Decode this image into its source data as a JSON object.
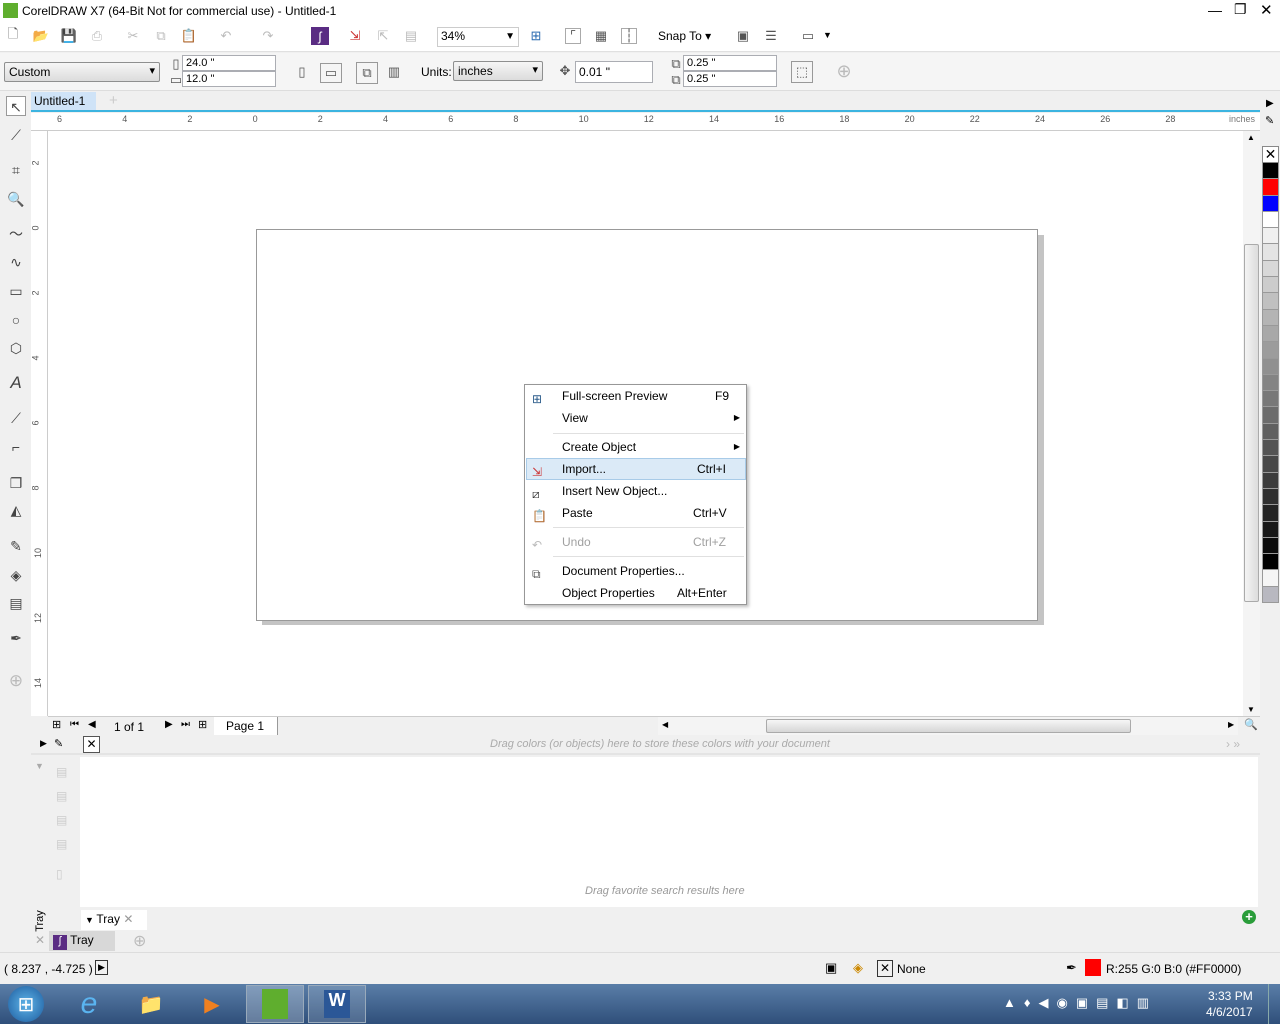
{
  "window": {
    "title": "CorelDRAW X7 (64-Bit Not for commercial use) - Untitled-1"
  },
  "toolbar": {
    "zoom": "34%",
    "snap_to": "Snap To"
  },
  "property_bar": {
    "page_size": "Custom",
    "width": "24.0 \"",
    "height": "12.0 \"",
    "units_label": "Units:",
    "units": "inches",
    "nudge": "0.01 \"",
    "dup_x": "0.25 \"",
    "dup_y": "0.25 \""
  },
  "document_tab": {
    "label": "Untitled-1"
  },
  "ruler": {
    "unit": "inches",
    "h_labels": [
      "6",
      "4",
      "2",
      "0",
      "2",
      "4",
      "6",
      "8",
      "10",
      "12",
      "14",
      "16",
      "18",
      "20",
      "22",
      "24",
      "26",
      "28"
    ],
    "v_labels": [
      "2",
      "0",
      "2",
      "4",
      "6",
      "8",
      "10",
      "12",
      "14"
    ]
  },
  "context_menu": {
    "items": [
      {
        "label": "Full-screen Preview",
        "shortcut": "F9",
        "icon": "fullscreen-preview-icon"
      },
      {
        "label": "View",
        "submenu": true
      },
      {
        "label": "Create Object",
        "submenu": true
      },
      {
        "label": "Import...",
        "shortcut": "Ctrl+I",
        "icon": "import-icon",
        "highlighted": true
      },
      {
        "label": "Insert New Object...",
        "icon": "insert-object-icon"
      },
      {
        "label": "Paste",
        "shortcut": "Ctrl+V",
        "icon": "paste-icon"
      },
      {
        "label": "Undo",
        "shortcut": "Ctrl+Z",
        "icon": "undo-icon",
        "disabled": true
      },
      {
        "label": "Document Properties...",
        "icon": "document-properties-icon"
      },
      {
        "label": "Object Properties",
        "shortcut": "Alt+Enter"
      }
    ]
  },
  "page_nav": {
    "count": "1 of 1",
    "page_tab": "Page 1"
  },
  "doc_palette": {
    "hint": "Drag colors (or objects) here to store these colors with your document"
  },
  "tray": {
    "hint": "Drag favorite search results here",
    "tab": "Tray",
    "bottom_tab": "Tray",
    "side_label": "Tray"
  },
  "status": {
    "coords": "( 8.237 , -4.725 )",
    "fill": "None",
    "outline": "R:255 G:0 B:0 (#FF0000)",
    "outline_color": "#FF0000"
  },
  "palette": [
    "#000000",
    "#FF0000",
    "#0000FF",
    "#FFFFFF",
    "#F0F0F0",
    "#E4E4E4",
    "#D8D8D8",
    "#CCCCCC",
    "#C0C0C0",
    "#B4B4B4",
    "#A8A8A8",
    "#9C9C9C",
    "#909090",
    "#848484",
    "#787878",
    "#6C6C6C",
    "#606060",
    "#545454",
    "#484848",
    "#3C3C3C",
    "#303030",
    "#242424",
    "#181818",
    "#0C0C0C",
    "#000000",
    "#F5F5F5",
    "#B8B8C0"
  ],
  "taskbar": {
    "time": "3:33 PM",
    "date": "4/6/2017"
  }
}
